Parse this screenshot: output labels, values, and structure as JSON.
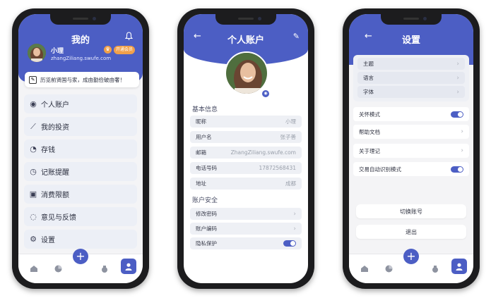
{
  "screen1": {
    "title": "我的",
    "user_name": "小理",
    "user_email": "zhangZiliang.swufe.com",
    "vip_label": "开通会员",
    "slogan": "历览前贤国与家，成由勤俭破由奢！",
    "menu": [
      {
        "label": "个人账户",
        "icon": "user-circle-icon"
      },
      {
        "label": "我的投资",
        "icon": "chart-line-icon"
      },
      {
        "label": "存钱",
        "icon": "piggy-bank-icon"
      },
      {
        "label": "记账提醒",
        "icon": "alarm-clock-icon"
      },
      {
        "label": "消费限额",
        "icon": "limit-icon"
      },
      {
        "label": "意见与反馈",
        "icon": "chat-bubble-icon"
      },
      {
        "label": "设置",
        "icon": "gear-icon"
      }
    ]
  },
  "screen2": {
    "title": "个人账户",
    "basic_section": "基本信息",
    "fields": [
      {
        "label": "昵称",
        "value": "小理"
      },
      {
        "label": "用户名",
        "value": "张子善"
      },
      {
        "label": "邮箱",
        "value": "ZhangZiliang.swufe.com"
      },
      {
        "label": "电话号码",
        "value": "17872568431"
      },
      {
        "label": "地址",
        "value": "成都"
      }
    ],
    "security_section": "账户安全",
    "security": [
      {
        "label": "修改密码"
      },
      {
        "label": "账户编码"
      },
      {
        "label": "隐私保护"
      }
    ]
  },
  "screen3": {
    "title": "设置",
    "group1": [
      {
        "label": "主题"
      },
      {
        "label": "语言"
      },
      {
        "label": "字体"
      }
    ],
    "group2": [
      {
        "label": "关怀模式"
      },
      {
        "label": "帮助文档"
      },
      {
        "label": "关于理记"
      },
      {
        "label": "交易自动识别模式"
      }
    ],
    "switch_account": "切换账号",
    "logout": "退出"
  },
  "colors": {
    "accent": "#4c5ec4",
    "card": "#eceff6",
    "vip": "#f0a04a"
  }
}
